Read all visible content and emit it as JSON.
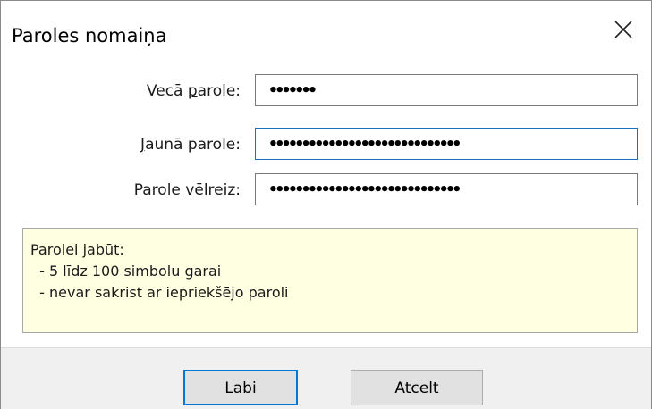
{
  "dialog": {
    "title": "Paroles nomaiņa",
    "close_icon": "close-icon"
  },
  "form": {
    "old_password": {
      "label_before": "Vecā ",
      "label_mnemonic": "p",
      "label_after": "arole:",
      "value": "•••••••"
    },
    "new_password": {
      "label_before": "",
      "label_mnemonic": "J",
      "label_after": "aunā parole:",
      "value": "•••••••••••••••••••••••••••••"
    },
    "confirm_password": {
      "label_before": "Parole ",
      "label_mnemonic": "v",
      "label_after": "ēlreiz:",
      "value": "•••••••••••••••••••••••••••••"
    }
  },
  "hint": {
    "heading": "Parolei jabūt:",
    "rules": [
      "  - 5 līdz 100 simbolu garai",
      "  - nevar sakrist ar iepriekšējo paroli"
    ]
  },
  "buttons": {
    "ok_label": "Labi",
    "cancel_label": "Atcelt"
  },
  "colors": {
    "hint_background": "#ffffe1",
    "focus_border": "#1a6fbf",
    "default_button_border": "#0078d7"
  }
}
